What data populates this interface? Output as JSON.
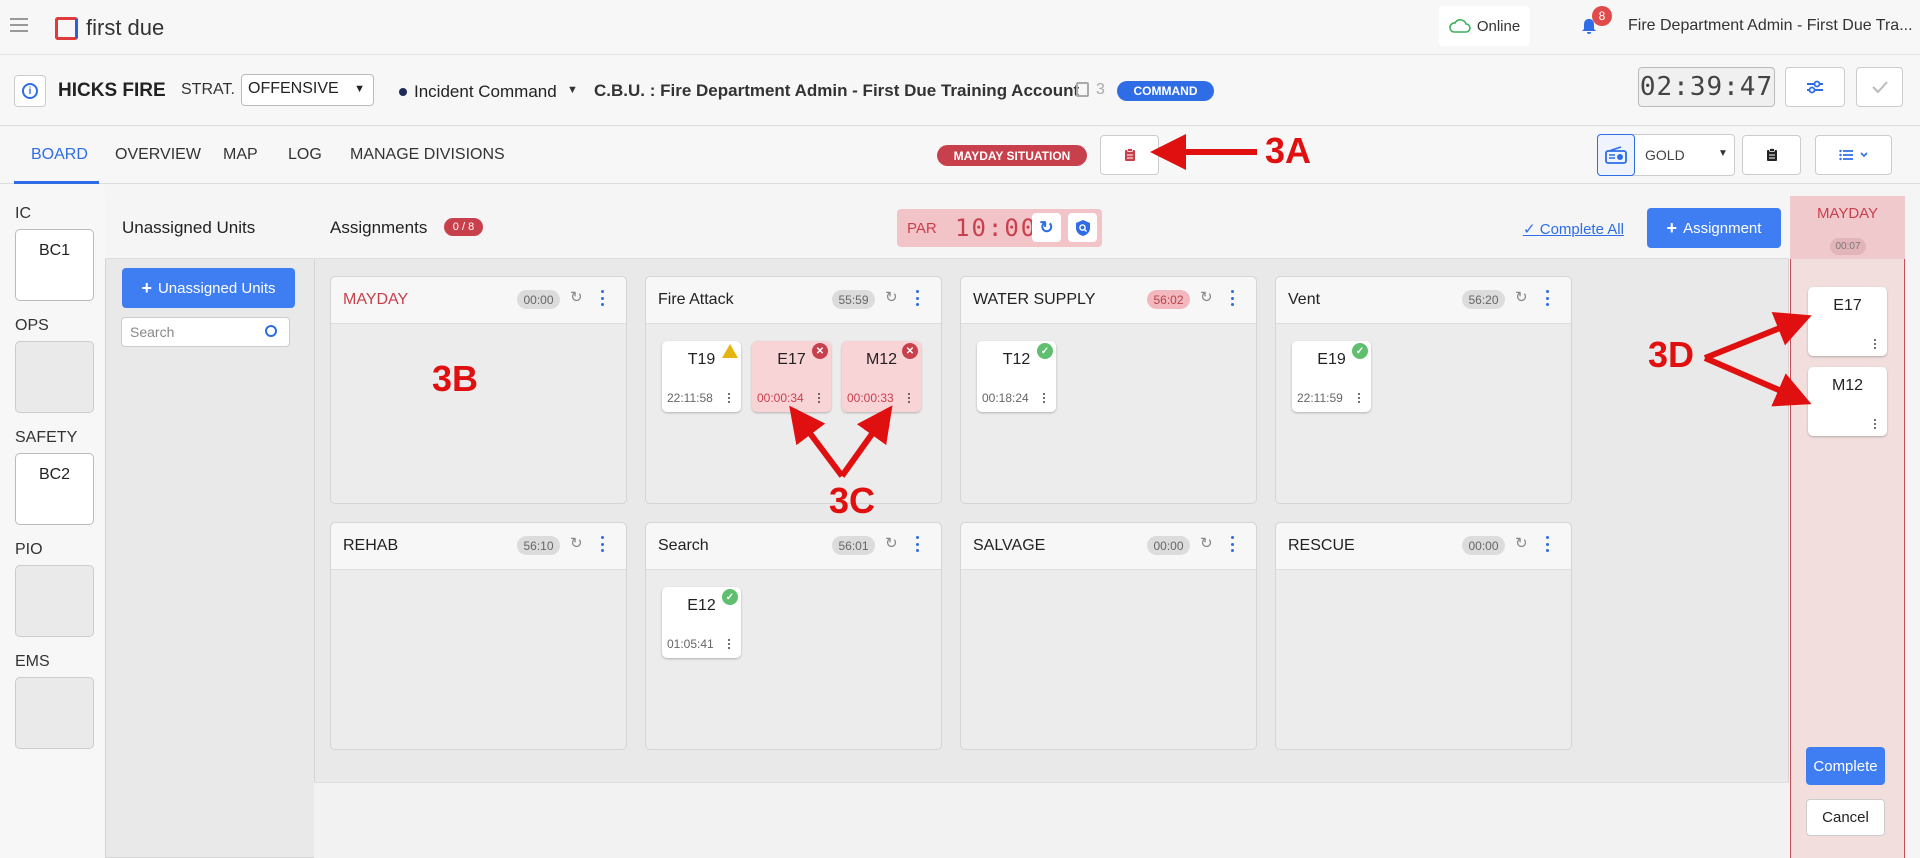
{
  "header": {
    "app_name": "first due",
    "online_label": "Online",
    "notification_count": "8",
    "account_name": "Fire Department Admin - First Due Tra..."
  },
  "incident": {
    "title": "HICKS FIRE",
    "strat_label": "STRAT.",
    "strat_value": "OFFENSIVE",
    "command_role": "Incident Command",
    "cbu": "C.B.U. : Fire Department Admin - First Due Training Account",
    "copy_count": "3",
    "command_badge": "COMMAND",
    "clock": "02:39:47"
  },
  "tabs": [
    "BOARD",
    "OVERVIEW",
    "MAP",
    "LOG",
    "MANAGE DIVISIONS"
  ],
  "toolbar": {
    "mayday_situation": "MAYDAY SITUATION",
    "radio_channel": "GOLD"
  },
  "positions": [
    {
      "label": "IC",
      "unit": "BC1"
    },
    {
      "label": "OPS",
      "unit": ""
    },
    {
      "label": "SAFETY",
      "unit": "BC2"
    },
    {
      "label": "PIO",
      "unit": ""
    },
    {
      "label": "EMS",
      "unit": ""
    }
  ],
  "unassigned": {
    "title": "Unassigned Units",
    "button": "Unassigned Units",
    "search_placeholder": "Search"
  },
  "assignments": {
    "title": "Assignments",
    "count_badge": "0 / 8",
    "par_label": "PAR",
    "par_time": "10:00",
    "complete_all": "Complete All",
    "add_button": "Assignment",
    "columns": [
      {
        "name": "MAYDAY",
        "timer": "00:00",
        "units": []
      },
      {
        "name": "Fire Attack",
        "timer": "55:59",
        "units": [
          {
            "name": "T19",
            "time": "22:11:58",
            "status": "warn"
          },
          {
            "name": "E17",
            "time": "00:00:34",
            "status": "mayday"
          },
          {
            "name": "M12",
            "time": "00:00:33",
            "status": "mayday"
          }
        ]
      },
      {
        "name": "WATER SUPPLY",
        "timer": "56:02",
        "units": [
          {
            "name": "T12",
            "time": "00:18:24",
            "status": "ok"
          }
        ]
      },
      {
        "name": "Vent",
        "timer": "56:20",
        "units": [
          {
            "name": "E19",
            "time": "22:11:59",
            "status": "ok"
          }
        ]
      },
      {
        "name": "REHAB",
        "timer": "56:10",
        "units": []
      },
      {
        "name": "Search",
        "timer": "56:01",
        "units": [
          {
            "name": "E12",
            "time": "01:05:41",
            "status": "ok"
          }
        ]
      },
      {
        "name": "SALVAGE",
        "timer": "00:00",
        "units": []
      },
      {
        "name": "RESCUE",
        "timer": "00:00",
        "units": []
      }
    ]
  },
  "mayday_panel": {
    "title": "MAYDAY",
    "timer": "00:07",
    "units": [
      "E17",
      "M12"
    ],
    "complete": "Complete",
    "cancel": "Cancel"
  },
  "annotations": {
    "a": "3A",
    "b": "3B",
    "c": "3C",
    "d": "3D"
  }
}
